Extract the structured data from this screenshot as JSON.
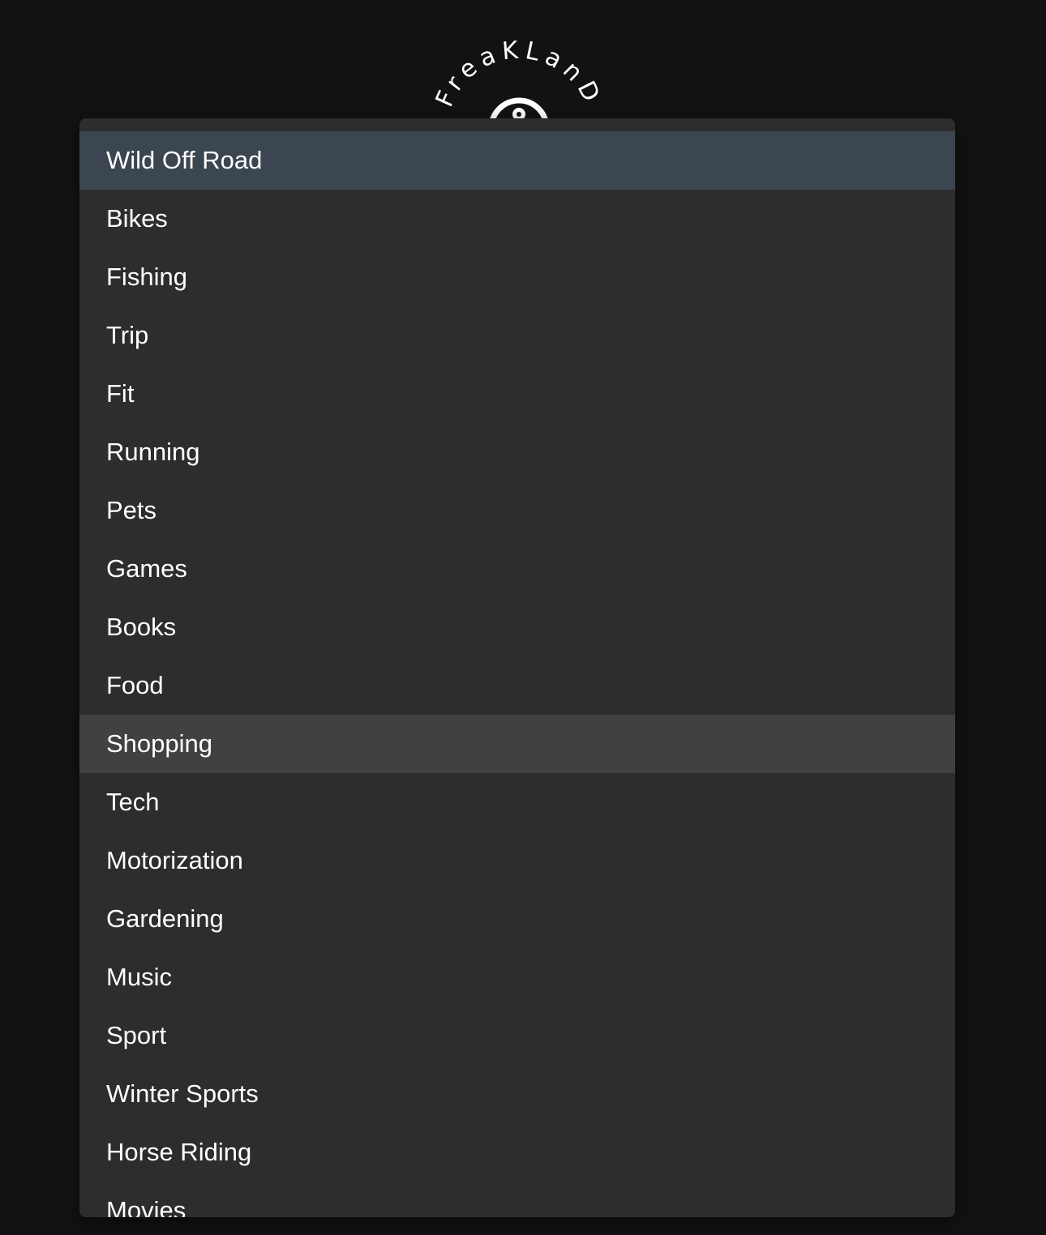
{
  "logo": {
    "brand_text": "FreaKLanD"
  },
  "dropdown": {
    "selected_index": 0,
    "hover_index": 10,
    "options": [
      {
        "label": "Wild Off Road"
      },
      {
        "label": "Bikes"
      },
      {
        "label": "Fishing"
      },
      {
        "label": "Trip"
      },
      {
        "label": "Fit"
      },
      {
        "label": "Running"
      },
      {
        "label": "Pets"
      },
      {
        "label": "Games"
      },
      {
        "label": "Books"
      },
      {
        "label": "Food"
      },
      {
        "label": "Shopping"
      },
      {
        "label": "Tech"
      },
      {
        "label": "Motorization"
      },
      {
        "label": "Gardening"
      },
      {
        "label": "Music"
      },
      {
        "label": "Sport"
      },
      {
        "label": "Winter Sports"
      },
      {
        "label": "Horse Riding"
      },
      {
        "label": "Movies"
      }
    ]
  },
  "colors": {
    "page_background": "#121212",
    "dropdown_background": "#2d2d2d",
    "selected_background": "#3c4650",
    "hover_background": "#414141",
    "text": "#ffffff"
  }
}
